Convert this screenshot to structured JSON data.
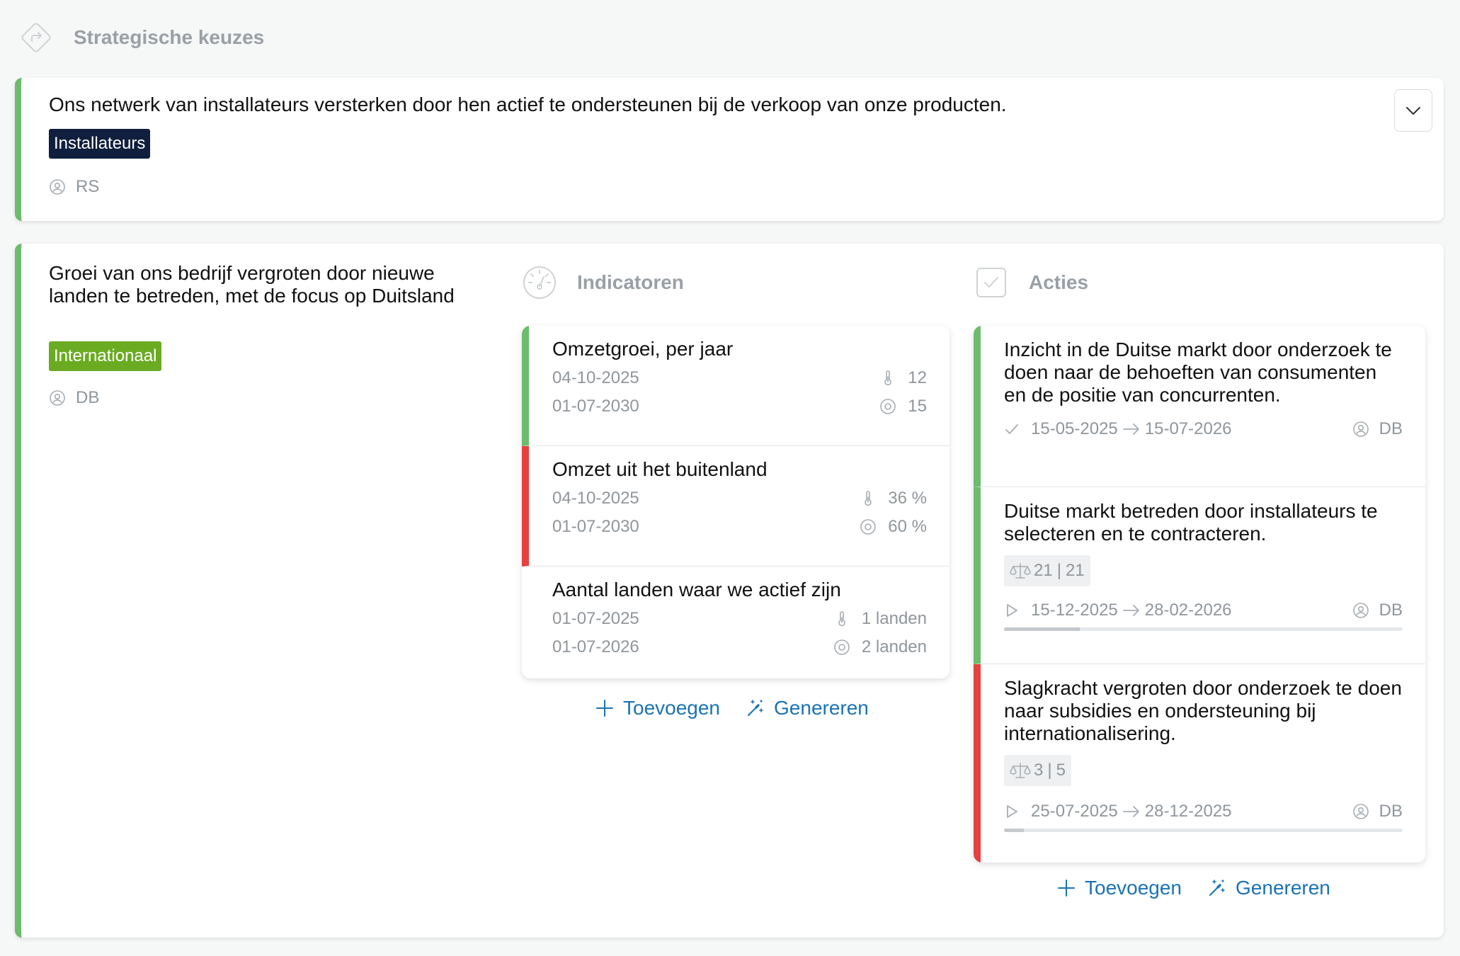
{
  "section": {
    "title": "Strategische keuzes",
    "icon": "direction-sign-icon"
  },
  "choices": [
    {
      "text": "Ons netwerk van installateurs versterken door hen actief te ondersteunen bij de verkoop van onze producten.",
      "tag": "Installateurs",
      "owner": "RS",
      "accent": "#6cbc6b"
    },
    {
      "text": "Groei van ons bedrijf vergroten door nieuwe landen te betreden, met de focus op Duitsland",
      "tag": "Internationaal",
      "owner": "DB",
      "accent": "#6cbc6b",
      "indicators": {
        "title": "Indicatoren",
        "items": [
          {
            "title": "Omzetgroei, per jaar",
            "start_date": "04-10-2025",
            "current": "12",
            "target_date": "01-07-2030",
            "target": "15",
            "status_color": "#6cbc6b"
          },
          {
            "title": "Omzet uit het buitenland",
            "start_date": "04-10-2025",
            "current": "36 %",
            "target_date": "01-07-2030",
            "target": "60 %",
            "status_color": "#e5413f"
          },
          {
            "title": "Aantal landen waar we actief zijn",
            "start_date": "01-07-2025",
            "current": "1 landen",
            "target_date": "01-07-2026",
            "target": "2 landen",
            "status_color": "#ffffff"
          }
        ],
        "add_label": "Toevoegen",
        "generate_label": "Genereren"
      },
      "actions": {
        "title": "Acties",
        "items": [
          {
            "title": "Inzicht in de Duitse markt door onderzoek te doen naar de behoeften van consumenten en de positie van concurrenten.",
            "status": "completed",
            "start": "15-05-2025",
            "end": "15-07-2026",
            "owner": "DB",
            "status_color": "#6cbc6b"
          },
          {
            "title": "Duitse markt betreden door installateurs te selecteren en te contracteren.",
            "score_a": "21",
            "score_b": "21",
            "status": "in-progress",
            "start": "15-12-2025",
            "end": "28-02-2026",
            "owner": "DB",
            "progress": 0.19,
            "status_color": "#6cbc6b"
          },
          {
            "title": "Slagkracht vergroten door onderzoek te doen naar subsidies en ondersteuning bij internationalisering.",
            "score_a": "3",
            "score_b": "5",
            "status": "in-progress",
            "start": "25-07-2025",
            "end": "28-12-2025",
            "owner": "DB",
            "progress": 0.05,
            "status_color": "#e5413f"
          }
        ],
        "add_label": "Toevoegen",
        "generate_label": "Genereren"
      }
    }
  ]
}
